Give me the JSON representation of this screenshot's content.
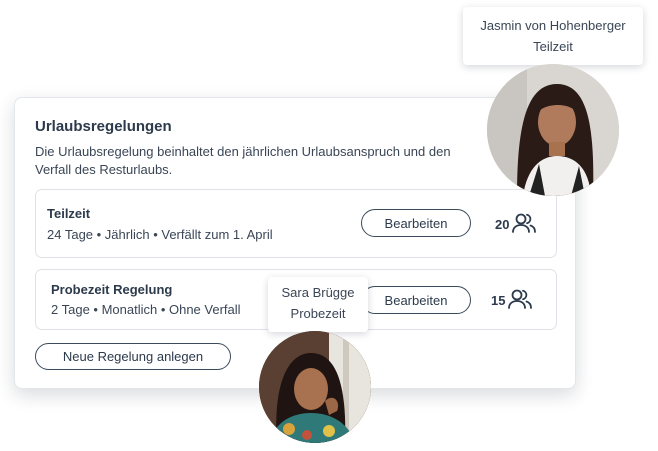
{
  "card": {
    "title": "Urlaubsregelungen",
    "description": "Die Urlaubsregelung beinhaltet den jährlichen Urlaubsanspruch und den Verfall des Resturlaubs.",
    "rules": [
      {
        "title": "Teilzeit",
        "details": "24 Tage • Jährlich • Verfällt zum 1. April",
        "edit_label": "Bearbeiten",
        "count": "20",
        "count_icon": "users-icon"
      },
      {
        "title": "Probezeit Regelung",
        "details": "2 Tage • Monatlich • Ohne Verfall",
        "edit_label": "Bearbeiten",
        "count": "15",
        "count_icon": "users-icon"
      }
    ],
    "new_rule_label": "Neue Regelung anlegen"
  },
  "people": [
    {
      "name": "Jasmin von Hohenberger",
      "role": "Teilzeit"
    },
    {
      "name": "Sara Brügge",
      "role": "Probezeit"
    }
  ]
}
